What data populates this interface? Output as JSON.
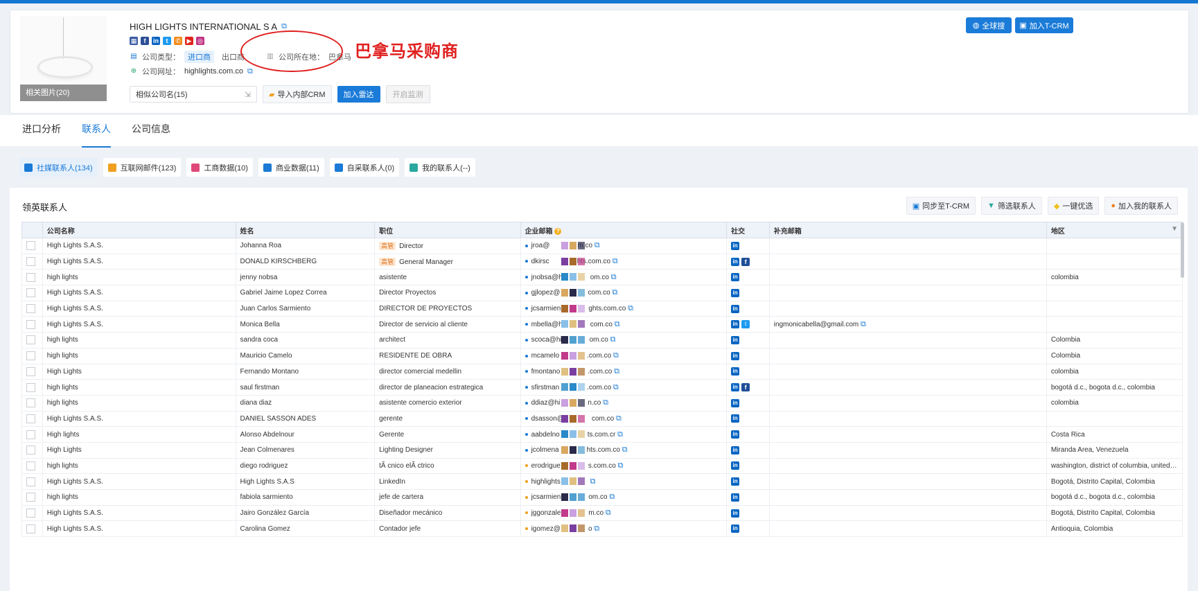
{
  "header": {
    "company_name": "HIGH LIGHTS INTERNATIONAL S A",
    "photos_label": "相关图片(20)",
    "social_icons": [
      "facebook-icon",
      "facebook-icon",
      "linkedin-icon",
      "twitter-icon",
      "phone-icon",
      "youtube-icon",
      "instagram-icon"
    ],
    "type_label": "公司类型：",
    "type_import": "进口商",
    "type_export": "出口商",
    "location_label": "公司所在地：",
    "location_value": "巴拿马",
    "website_label": "公司网址：",
    "website_value": "highlights.com.co",
    "annotation": "巴拿马采购商",
    "global_search": "全球搜",
    "add_tcrm": "加入T-CRM",
    "similar_companies": "相似公司名(15)",
    "import_crm": "导入内部CRM",
    "add_radar": "加入雷达",
    "start_monitor": "开启监测"
  },
  "main_tabs": [
    "进口分析",
    "联系人",
    "公司信息"
  ],
  "sub_tabs": [
    {
      "label": "社媒联系人(134)",
      "color": "#1a7ad6"
    },
    {
      "label": "互联网邮件(123)",
      "color": "#f0a020"
    },
    {
      "label": "工商数据(10)",
      "color": "#e04a7a"
    },
    {
      "label": "商业数据(11)",
      "color": "#1a7ad6"
    },
    {
      "label": "自采联系人(0)",
      "color": "#1a7ad6"
    },
    {
      "label": "我的联系人(--)",
      "color": "#2aa8a0"
    }
  ],
  "contacts": {
    "title": "领英联系人",
    "buttons": [
      "同步至T-CRM",
      "筛选联系人",
      "一键优选",
      "加入我的联系人"
    ],
    "columns": [
      "公司名称",
      "姓名",
      "职位",
      "企业邮箱",
      "社交",
      "补充邮箱",
      "地区"
    ],
    "rows": [
      {
        "company": "High Lights S.A.S.",
        "name": "Johanna Roa",
        "badge": "高管",
        "title": "Director",
        "email": "jroa@",
        "email_end": "m.co",
        "social": "li",
        "extra": "",
        "region": ""
      },
      {
        "company": "High Lights S.A.S.",
        "name": "DONALD KIRSCHBERG",
        "badge": "高管",
        "title": "General Manager",
        "email": "dkirsc",
        "email_end": "hts.com.co",
        "social": "li,fb",
        "extra": "",
        "region": ""
      },
      {
        "company": "high lights",
        "name": "jenny nobsa",
        "badge": "",
        "title": "asistente",
        "email": "jnobsa@h",
        "email_end": "om.co",
        "social": "li",
        "extra": "",
        "region": "colombia"
      },
      {
        "company": "High Lights S.A.S.",
        "name": "Gabriel Jaime Lopez Correa",
        "badge": "",
        "title": "Director Proyectos",
        "email": "gjlopez@",
        "email_end": "com.co",
        "social": "li",
        "extra": "",
        "region": ""
      },
      {
        "company": "High Lights S.A.S.",
        "name": "Juan Carlos Sarmiento",
        "badge": "",
        "title": "DIRECTOR DE PROYECTOS",
        "email": "jcsarmien",
        "email_end": "ghts.com.co",
        "social": "li",
        "extra": "",
        "region": ""
      },
      {
        "company": "High Lights S.A.S.",
        "name": "Monica Bella",
        "badge": "",
        "title": "Director de servicio al cliente",
        "email": "mbella@h",
        "email_end": "com.co",
        "social": "li,tw",
        "extra": "ingmonicabella@gmail.com",
        "region": ""
      },
      {
        "company": "high lights",
        "name": "sandra coca",
        "badge": "",
        "title": "architect",
        "email": "scoca@hi",
        "email_end": "om.co",
        "social": "li",
        "extra": "",
        "region": "Colombia"
      },
      {
        "company": "high lights",
        "name": "Mauricio Camelo",
        "badge": "",
        "title": "RESIDENTE DE OBRA",
        "email": "mcamelo",
        "email_end": ".com.co",
        "social": "li",
        "extra": "",
        "region": "Colombia"
      },
      {
        "company": "High Lights",
        "name": "Fernando Montano",
        "badge": "",
        "title": "director comercial medellin",
        "email": "fmontano",
        "email_end": ".com.co",
        "social": "li",
        "extra": "",
        "region": "colombia"
      },
      {
        "company": "high lights",
        "name": "saul firstman",
        "badge": "",
        "title": "director de planeacion estrategica",
        "email": "sfirstman",
        "email_end": ".com.co",
        "social": "li,fb",
        "extra": "",
        "region": "bogotá d.c., bogota d.c., colombia"
      },
      {
        "company": "high lights",
        "name": "diana diaz",
        "badge": "",
        "title": "asistente comercio exterior",
        "email": "ddiaz@hi",
        "email_end": "n.co",
        "social": "li",
        "extra": "",
        "region": "colombia"
      },
      {
        "company": "High Lights S.A.S.",
        "name": "DANIEL SASSON ADES",
        "badge": "",
        "title": "gerente",
        "email": "dsasson@",
        "email_end": "com.co",
        "social": "li",
        "extra": "",
        "region": ""
      },
      {
        "company": "High lights",
        "name": "Alonso Abdelnour",
        "badge": "",
        "title": "Gerente",
        "email": "aabdelno",
        "email_end": "ts.com.cr",
        "social": "li",
        "extra": "",
        "region": "Costa Rica"
      },
      {
        "company": "High Lights",
        "name": "Jean Colmenares",
        "badge": "",
        "title": "Lighting Designer",
        "email": "jcolmena",
        "email_end": "hts.com.co",
        "social": "li",
        "extra": "",
        "region": "Miranda Area, Venezuela"
      },
      {
        "company": "high lights",
        "name": "diego rodriguez",
        "badge": "",
        "title": "tÃ cnico elÃ ctrico",
        "email": "erodrigue",
        "email_end": "s.com.co",
        "social": "li",
        "extra": "",
        "region": "washington, district of columbia, united s..."
      },
      {
        "company": "High Lights S.A.S.",
        "name": "High Lights S.A.S",
        "badge": "",
        "title": "LinkedIn",
        "email": "highlights",
        "email_end": "",
        "social": "li",
        "extra": "",
        "region": "Bogotá, Distrito Capital, Colombia"
      },
      {
        "company": "high lights",
        "name": "fabiola sarmiento",
        "badge": "",
        "title": "jefe de cartera",
        "email": "jcsarmien",
        "email_end": "om.co",
        "social": "li",
        "extra": "",
        "region": "bogotá d.c., bogota d.c., colombia"
      },
      {
        "company": "High Lights S.A.S.",
        "name": "Jairo González García",
        "badge": "",
        "title": "Diseñador mecánico",
        "email": "jggonzale",
        "email_end": "m.co",
        "social": "li",
        "extra": "",
        "region": "Bogotá, Distrito Capital, Colombia"
      },
      {
        "company": "High Lights S.A.S.",
        "name": "Carolina Gomez",
        "badge": "",
        "title": "Contador jefe",
        "email": "igomez@",
        "email_end": "o",
        "social": "li",
        "extra": "",
        "region": "Antioquia, Colombia"
      }
    ]
  }
}
